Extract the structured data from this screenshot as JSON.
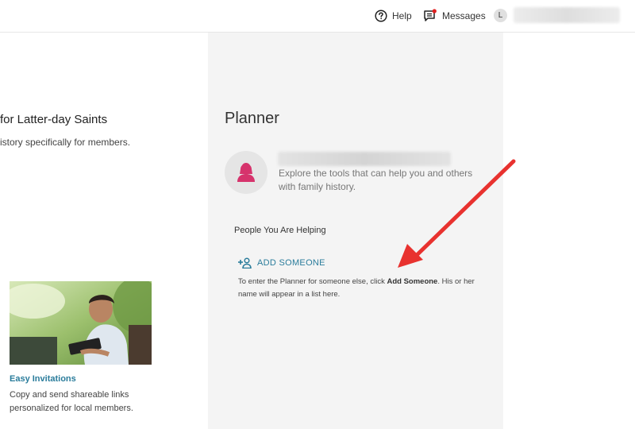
{
  "header": {
    "help_label": "Help",
    "messages_label": "Messages",
    "avatar_initial": "L"
  },
  "left": {
    "title": "for Latter-day Saints",
    "subtitle": "istory specifically for members.",
    "promo": {
      "title": "Easy Invitations",
      "description": "Copy and send shareable links personalized for local members."
    }
  },
  "planner": {
    "title": "Planner",
    "description": "Explore the tools that can help you and others with family history.",
    "helping_label": "People You Are Helping",
    "add_label": "ADD SOMEONE",
    "add_help_pre": "To enter the Planner for someone else, click ",
    "add_help_bold": "Add Someone",
    "add_help_post": ". His or her name will appear in a list here."
  },
  "colors": {
    "link": "#2a7c9b",
    "avatar_pink": "#d6336c",
    "arrow": "#e8322f",
    "notification_dot": "#e02020"
  },
  "icons": {
    "help": "question-circle-icon",
    "messages": "chat-icon",
    "add": "add-person-icon",
    "planner_avatar": "person-silhouette-icon"
  }
}
